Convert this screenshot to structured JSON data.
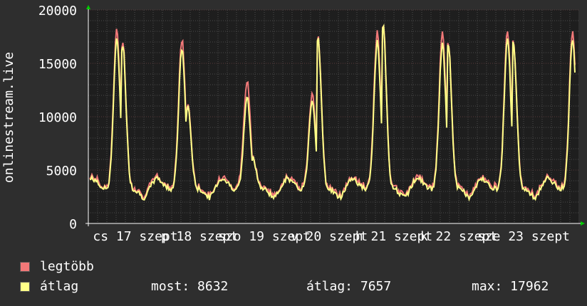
{
  "chart_data": {
    "type": "line",
    "ylabel": "onlinestream.live",
    "ylim": [
      0,
      20000
    ],
    "y_ticks": [
      "0",
      "5000",
      "10000",
      "15000",
      "20000"
    ],
    "x_ticks": [
      "cs 17 szept",
      "p 18 szept",
      "szo 19 szept",
      "v 20 szept",
      "h 21 szept",
      "k 22 szept",
      "sze 23 szept"
    ],
    "x_tick_display": [
      "cs 17 szept",
      "p 18 szept",
      "szo 19 szept",
      "v 20 szept",
      "h 21 szept",
      "k 22 szept",
      "sze 23 szept"
    ],
    "grid": true,
    "colors": {
      "background": "#2e2e2e",
      "plot_bg": "#1e1e1e",
      "grid": "#4a4a4a",
      "max_line": "#f07878",
      "avg_line": "#ffff88",
      "axis_arrow": "#00cc00"
    },
    "series": [
      {
        "name": "legtöbb",
        "color": "#f07878"
      },
      {
        "name": "átlag",
        "color": "#ffff88"
      }
    ],
    "day_peaks": [
      {
        "day": "cs 17 szept",
        "peak_max": 17800,
        "peak_avg": 17200,
        "evening": 16200
      },
      {
        "day": "p 18 szept",
        "peak_max": 17100,
        "peak_avg": 16400,
        "evening": 16800
      },
      {
        "day": "szo 19 szept",
        "peak_max": 13100,
        "peak_avg": 11800,
        "evening": 11000
      },
      {
        "day": "v 20 szept",
        "peak_max": 12100,
        "peak_avg": 11600,
        "evening": 6200
      },
      {
        "day": "h 21 szept",
        "peak_max": 17700,
        "peak_avg": 17000,
        "evening": 17400
      },
      {
        "day": "k 22 szept",
        "peak_max": 17600,
        "peak_avg": 16800,
        "evening": 18400
      },
      {
        "day": "sze 23 szept",
        "peak_max": 17962,
        "peak_avg": 17400,
        "evening": 16900
      }
    ]
  },
  "legend": {
    "max_label": "legtöbb",
    "avg_label": "átlag",
    "current": "most: 8632",
    "average": "átlag: 7657",
    "maximum": "max: 17962"
  }
}
